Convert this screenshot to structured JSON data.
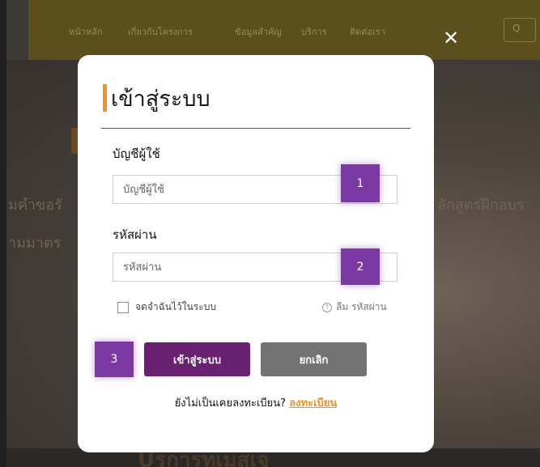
{
  "background": {
    "nav_links": [
      "หน้าหลัก",
      "เกี่ยวกับโครงการ",
      "ข้อมูลสำคัญ",
      "บริการ",
      "ติดต่อเรา"
    ],
    "hero_line_1": "มคำขอรั",
    "hero_line_2": "ามมาตร",
    "hero_right_text": "ลักสูตรฝึกอบร",
    "bottom_text": "Uรการทเมสเจ"
  },
  "modal": {
    "title": "เข้าสู่ระบบ",
    "username_label": "บัญชีผู้ใช้",
    "username_placeholder": "บัญชีผู้ใช้",
    "password_label": "รหัสผ่าน",
    "password_placeholder": "รหัสผ่าน",
    "remember_label": "จดจำฉันไว้ในระบบ",
    "forgot_icon": "?",
    "forgot_label": "ลืม รหัสผ่าน",
    "login_button": "เข้าสู่ระบบ",
    "cancel_button": "ยกเลิก",
    "register_prompt": "ยังไม่เป็นเคยลงทะเบียน?",
    "register_link": "ลงทะเบียน",
    "close_symbol": "✕"
  },
  "markers": [
    "1",
    "2",
    "3"
  ],
  "colors": {
    "accent_orange": "#f39122",
    "login_purple": "#6a2070",
    "cancel_gray": "#737373",
    "marker_purple": "#7b3aa3"
  }
}
